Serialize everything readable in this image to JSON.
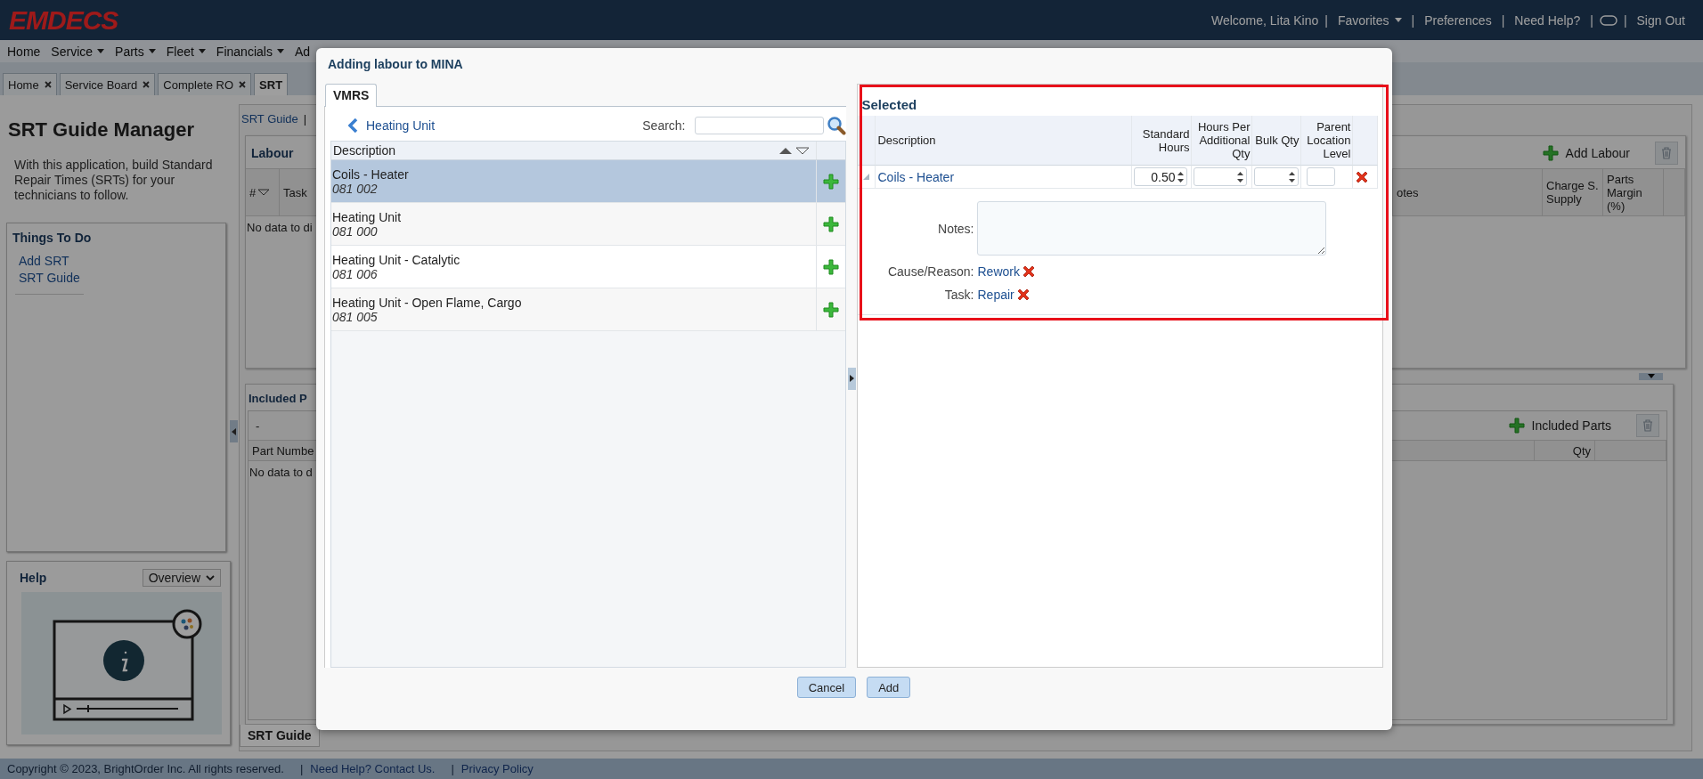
{
  "header": {
    "logo": "EMDECS",
    "items": [
      {
        "kind": "text",
        "label": "Welcome, Lita Kino"
      },
      {
        "kind": "sep",
        "label": "|"
      },
      {
        "kind": "menu",
        "label": "Favorites"
      },
      {
        "kind": "sep",
        "label": "|"
      },
      {
        "kind": "link",
        "label": "Preferences"
      },
      {
        "kind": "sep",
        "label": "|"
      },
      {
        "kind": "link",
        "label": "Need Help?"
      },
      {
        "kind": "sep",
        "label": "|"
      },
      {
        "kind": "toggle"
      },
      {
        "kind": "sep",
        "label": "|"
      },
      {
        "kind": "link",
        "label": "Sign Out"
      }
    ]
  },
  "menu": [
    {
      "label": "Home",
      "dropdown": false
    },
    {
      "label": "Service",
      "dropdown": true
    },
    {
      "label": "Parts",
      "dropdown": true
    },
    {
      "label": "Fleet",
      "dropdown": true
    },
    {
      "label": "Financials",
      "dropdown": true
    },
    {
      "label": "Ad",
      "dropdown": false
    }
  ],
  "tabs": [
    {
      "label": "Home",
      "closable": true,
      "selected": false
    },
    {
      "label": "Service Board",
      "closable": true,
      "selected": false
    },
    {
      "label": "Complete RO",
      "closable": true,
      "selected": false
    },
    {
      "label": "SRT",
      "closable": false,
      "selected": true
    }
  ],
  "sidebar": {
    "title": "SRT Guide Manager",
    "description": "With this application, build Standard Repair Times (SRTs) for your technicians to follow.",
    "things_to_do": {
      "title": "Things To Do",
      "links": [
        "Add SRT",
        "SRT Guide"
      ]
    },
    "help": {
      "title": "Help",
      "dropdown": "Overview"
    }
  },
  "content": {
    "top_links": [
      {
        "kind": "link",
        "label": "SRT Guide"
      },
      {
        "kind": "sep",
        "label": "|"
      }
    ],
    "labour": {
      "title": "Labour",
      "add_button": "Add Labour",
      "columns": [
        "#",
        "Task",
        "otes",
        "Charge S. Supply",
        "Parts Margin (%)"
      ],
      "empty": "No data to di"
    },
    "included": {
      "title": "Included P",
      "dash": "-",
      "add_button": "Included Parts",
      "columns": [
        "Part Numbe",
        "Qty"
      ],
      "empty": "No data to d"
    },
    "bottom_tab": "SRT Guide"
  },
  "dialog": {
    "title": "Adding labour to MINA",
    "tabs": [
      {
        "label": "VMRS",
        "selected": true
      }
    ],
    "breadcrumb": "Heating Unit",
    "search": {
      "label": "Search:"
    },
    "columns": [
      "Description"
    ],
    "rows": [
      {
        "description": "Coils - Heater",
        "code": "081 002",
        "selected": true
      },
      {
        "description": "Heating Unit",
        "code": "081 000",
        "selected": false
      },
      {
        "description": "Heating Unit - Catalytic",
        "code": "081 006",
        "selected": false
      },
      {
        "description": "Heating Unit - Open Flame, Cargo",
        "code": "081 005",
        "selected": false
      }
    ],
    "selected_panel": {
      "title": "Selected",
      "columns": [
        "Description",
        "Standard Hours",
        "Hours Per Additional Qty",
        "Bulk Qty",
        "Parent Location Level"
      ],
      "rows": [
        {
          "cells": [
            {
              "kind": "link",
              "text": "Coils - Heater"
            },
            {
              "kind": "spinner",
              "value": "0.50"
            },
            {
              "kind": "spinner"
            },
            {
              "kind": "spinner"
            },
            {
              "kind": "field"
            }
          ]
        }
      ],
      "notes_label": "Notes:",
      "details": [
        {
          "label": "Cause/Reason:",
          "value": "Rework"
        },
        {
          "label": "Task:",
          "value": "Repair"
        }
      ]
    },
    "buttons": [
      "Cancel",
      "Add"
    ]
  },
  "footer": [
    {
      "kind": "text",
      "label": "Copyright © 2023, BrightOrder Inc. All rights reserved."
    },
    {
      "kind": "sep",
      "label": "|"
    },
    {
      "kind": "link",
      "label": "Need Help? Contact Us."
    },
    {
      "kind": "sep",
      "label": "|"
    },
    {
      "kind": "link",
      "label": "Privacy Policy"
    }
  ]
}
